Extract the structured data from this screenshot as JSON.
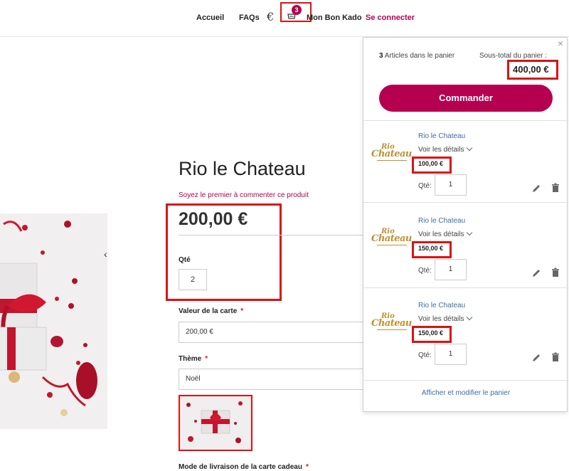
{
  "header": {
    "nav": [
      {
        "label": "Accueil"
      },
      {
        "label": "FAQs"
      },
      {
        "label": "Mon Bon Kado"
      },
      {
        "label": "Se connecter"
      }
    ],
    "currency_symbol": "€",
    "cart_count": "3",
    "cart_icon": "cart-icon"
  },
  "product": {
    "title": "Rio le Chateau",
    "review_link": "Soyez le premier à commenter ce produit",
    "price": "200,00 €",
    "qty_label": "Qté",
    "qty_value": "2",
    "card_value_label": "Valeur de la carte",
    "card_value": "200,00 €",
    "theme_label": "Thème",
    "theme_value": "Noël",
    "delivery_label": "Mode de livraison de la carte cadeau",
    "required_mark": "*",
    "gallery_next": "‹"
  },
  "minicart": {
    "close": "×",
    "count": "3",
    "count_text": "Articles dans le panier",
    "subtotal_label": "Sous-total du panier :",
    "subtotal": "400,00 €",
    "checkout_label": "Commander",
    "logo_top": "Rio",
    "logo_main": "Chateau",
    "details_label": "Voir les détails",
    "qty_label": "Qté:",
    "items": [
      {
        "name": "Rio le Chateau",
        "price": "100,00 €",
        "qty": "1"
      },
      {
        "name": "Rio le Chateau",
        "price": "150,00 €",
        "qty": "1"
      },
      {
        "name": "Rio le Chateau",
        "price": "150,00 €",
        "qty": "1"
      }
    ],
    "view_cart": "Afficher et modifier le panier"
  },
  "colors": {
    "accent": "#b5004f",
    "highlight": "#e01010",
    "link": "#3a6ea5",
    "logo_gold": "#c09030"
  }
}
